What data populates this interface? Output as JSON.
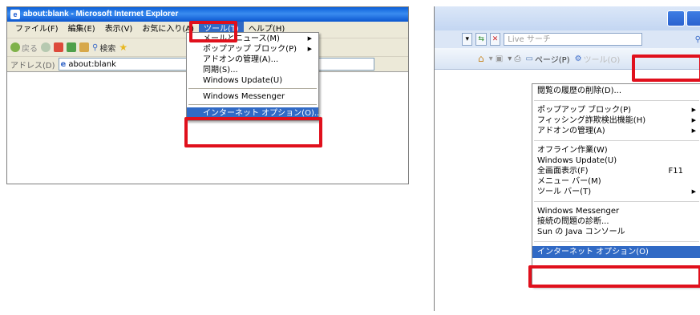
{
  "ie6": {
    "title": "about:blank - Microsoft Internet Explorer",
    "menubar": [
      "ファイル(F)",
      "編集(E)",
      "表示(V)",
      "お気に入り(A)",
      "ツール(T)",
      "ヘルプ(H)"
    ],
    "toolbar": {
      "back": "戻る",
      "search": "検索"
    },
    "address_label": "アドレス(D)",
    "address_value": "about:blank",
    "tools_menu": {
      "items": [
        {
          "label": "メールとニュース(M)",
          "submenu": true
        },
        {
          "label": "ポップアップ ブロック(P)",
          "submenu": true
        },
        {
          "label": "アドオンの管理(A)..."
        },
        {
          "label": "同期(S)..."
        },
        {
          "label": "Windows Update(U)"
        },
        {
          "sep": true
        },
        {
          "label": "Windows Messenger"
        },
        {
          "sep": true
        },
        {
          "label": "インターネット オプション(O)...",
          "highlight": true
        }
      ]
    }
  },
  "ie7": {
    "search_placeholder": "Live サーチ",
    "page_label": "ページ(P)",
    "tools_label": "ツール(O)",
    "tools_menu": {
      "items": [
        {
          "label": "閲覧の履歴の削除(D)..."
        },
        {
          "sep": true
        },
        {
          "label": "ポップアップ ブロック(P)",
          "submenu": true
        },
        {
          "label": "フィッシング詐欺検出機能(H)",
          "submenu": true
        },
        {
          "label": "アドオンの管理(A)",
          "submenu": true
        },
        {
          "sep": true
        },
        {
          "label": "オフライン作業(W)"
        },
        {
          "label": "Windows Update(U)"
        },
        {
          "label": "全画面表示(F)",
          "shortcut": "F11"
        },
        {
          "label": "メニュー バー(M)"
        },
        {
          "label": "ツール バー(T)",
          "submenu": true
        },
        {
          "sep": true
        },
        {
          "label": "Windows Messenger"
        },
        {
          "label": "接続の問題の診断..."
        },
        {
          "label": "Sun の Java コンソール"
        },
        {
          "sep": true
        },
        {
          "label": "インターネット オプション(O)",
          "highlight": true
        }
      ]
    }
  },
  "colors": {
    "highlight_red": "#e0101c",
    "menu_select": "#316ac5",
    "xp_title": "#0a5fd9"
  }
}
